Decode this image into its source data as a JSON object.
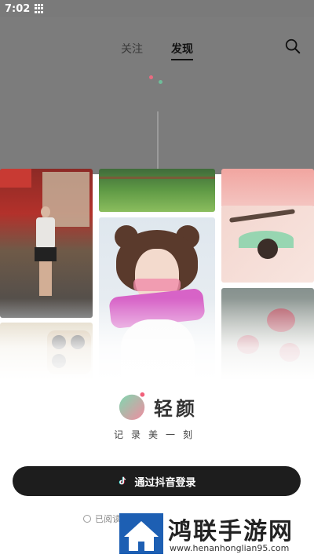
{
  "status_bar": {
    "time": "7:02"
  },
  "header": {
    "tabs": [
      {
        "label": "关注",
        "active": false
      },
      {
        "label": "发现",
        "active": true
      }
    ]
  },
  "brand": {
    "name": "轻颜",
    "slogan": "记录美一刻",
    "logo_colors": [
      "#f18ca0",
      "#7fd8b0"
    ]
  },
  "login": {
    "button_label": "通过抖音登录"
  },
  "agreement": {
    "text": "已阅读"
  },
  "watermark": {
    "title": "鸿联手游网",
    "url": "www.henanhonglian95.com"
  },
  "colors": {
    "button_bg": "#1d1d1d",
    "accent_pink": "#f18ca0",
    "accent_green": "#7fd8b0"
  },
  "icons": [
    "grid-icon",
    "search-icon",
    "tiktok-icon",
    "checkbox-circle-icon"
  ]
}
